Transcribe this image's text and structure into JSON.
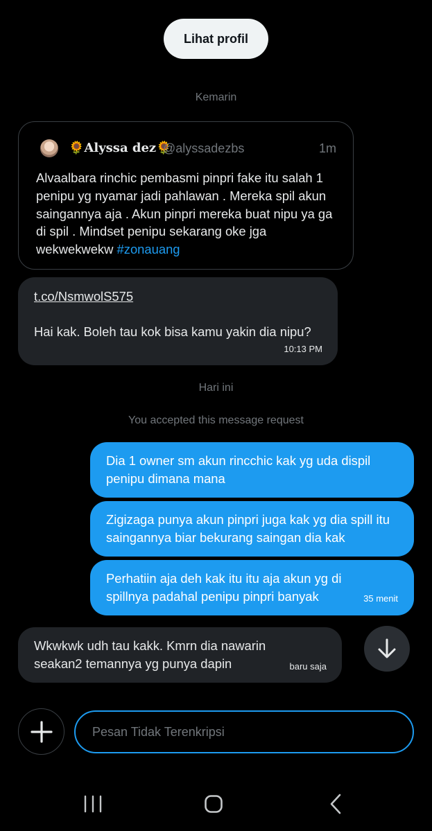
{
  "header": {
    "view_profile_label": "Lihat profil"
  },
  "dividers": {
    "yesterday": "Kemarin",
    "today": "Hari ini"
  },
  "quoted_post": {
    "name": "🌻Alyssa dez🌻",
    "handle": "@alyssadezbs",
    "time": "1m",
    "text": "Alvaalbara rinchic pembasmi pinpri fake itu salah 1 penipu yg nyamar jadi pahlawan . Mereka spil akun saingannya aja . Akun pinpri mereka buat nipu ya ga di spil . Mindset penipu sekarang oke jga wekwekwekw ",
    "hashtag": "#zonauang"
  },
  "messages": [
    {
      "direction": "in",
      "link": "t.co/NsmwolS575",
      "text": "Hai kak. Boleh tau kok bisa kamu yakin dia nipu?",
      "time": "10:13 PM"
    },
    {
      "direction": "out",
      "text": "Dia 1 owner sm akun rincchic kak yg uda dispil penipu dimana mana"
    },
    {
      "direction": "out",
      "text": "Zigizaga punya akun pinpri juga kak yg dia spill itu saingannya biar bekurang saingan dia kak"
    },
    {
      "direction": "out",
      "text": "Perhatiin aja deh kak itu itu aja akun yg di spillnya padahal penipu pinpri banyak",
      "time": "35 menit"
    },
    {
      "direction": "in",
      "text": "Wkwkwk udh tau kakk. Kmrn dia nawarin seakan2 temannya yg punya dapin",
      "time": "baru saja"
    }
  ],
  "system_notice": "You accepted this message request",
  "composer": {
    "placeholder": "Pesan Tidak Terenkripsi",
    "value": ""
  },
  "icons": {
    "scroll": "arrow-down-icon",
    "add": "plus-icon",
    "nav_recent": "recent-apps-icon",
    "nav_home": "home-icon",
    "nav_back": "back-icon"
  },
  "colors": {
    "accent": "#1d9bf0",
    "incoming_bubble": "#202327",
    "background": "#000000",
    "muted_text": "#71767b"
  }
}
